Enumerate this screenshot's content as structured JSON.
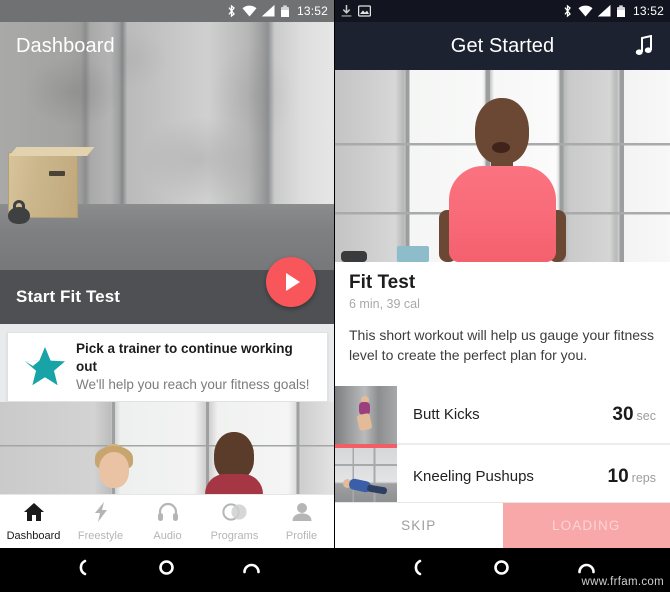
{
  "left_phone": {
    "statusbar": {
      "clock": "13:52",
      "icons": [
        "bluetooth-icon",
        "wifi-icon",
        "signal-icon",
        "battery-icon"
      ]
    },
    "appbar": {
      "title": "Dashboard"
    },
    "hero": {
      "alt": "gym-interior-with-plyo-box-and-kettlebell"
    },
    "start_bar": {
      "label": "Start Fit Test",
      "fab": "play-icon",
      "fab_color": "#f9565b"
    },
    "trainer_card": {
      "icon": "star-icon",
      "icon_color": "#18a3a6",
      "title": "Pick a trainer to continue working out",
      "subtitle": "We'll help you reach your fitness goals!"
    },
    "trainers_photo": {
      "alt": "two-trainers-smiling"
    },
    "tabs": [
      {
        "label": "Dashboard",
        "icon": "home-icon",
        "active": true
      },
      {
        "label": "Freestyle",
        "icon": "lightning-bolt-icon",
        "active": false
      },
      {
        "label": "Audio",
        "icon": "headphones-icon",
        "active": false
      },
      {
        "label": "Programs",
        "icon": "overlapping-circles-icon",
        "active": false
      },
      {
        "label": "Profile",
        "icon": "person-icon",
        "active": false
      }
    ]
  },
  "right_phone": {
    "statusbar": {
      "clock": "13:52",
      "left_icons": [
        "download-icon",
        "image-icon"
      ],
      "right_icons": [
        "bluetooth-icon",
        "wifi-icon",
        "signal-icon",
        "battery-icon"
      ]
    },
    "appbar": {
      "title": "Get Started",
      "action_icon": "music-note-icon",
      "bg_color": "#1d2231"
    },
    "hero": {
      "alt": "trainer-in-pink-shirt"
    },
    "workout": {
      "title": "Fit Test",
      "meta": "6 min, 39 cal",
      "description": "This short workout will help us gauge your fitness level to create the perfect plan for you."
    },
    "exercises": [
      {
        "name": "Butt Kicks",
        "qty": "30",
        "unit": "sec",
        "thumb": "runner-thumbnail",
        "progress": true
      },
      {
        "name": "Kneeling Pushups",
        "qty": "10",
        "unit": "reps",
        "thumb": "pushup-thumbnail",
        "progress": false
      }
    ],
    "actions": {
      "skip_label": "SKIP",
      "loading_label": "LOADING",
      "loading_color": "#f8a8a9"
    }
  },
  "navbar": {
    "buttons": [
      "back-icon",
      "home-icon",
      "recents-icon"
    ]
  },
  "watermark": "www.frfam.com"
}
